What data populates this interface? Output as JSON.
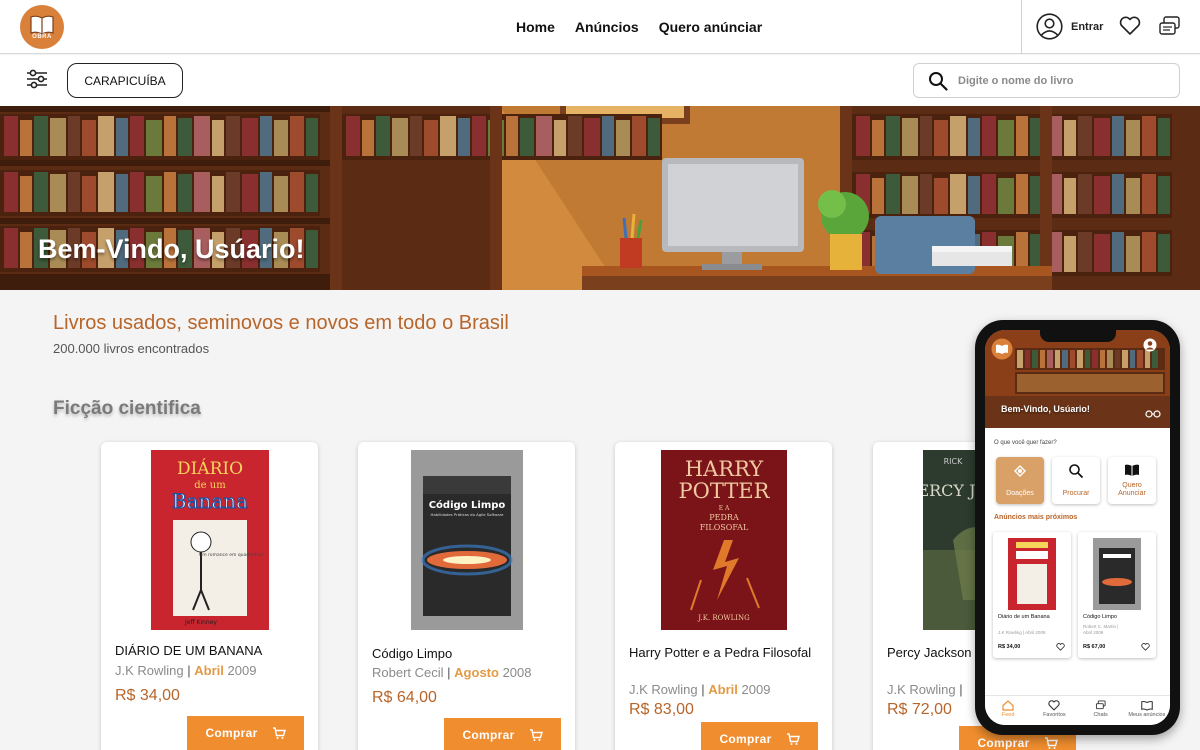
{
  "header": {
    "logo_text": "OBRA",
    "nav": [
      "Home",
      "Anúncios",
      "Quero anúnciar"
    ],
    "login_label": "Entrar"
  },
  "filters": {
    "city": "CARAPICUÍBA",
    "search_placeholder": "Digite o nome do livro"
  },
  "hero": {
    "title": "Bem-Vindo, Usúario!"
  },
  "main": {
    "headline": "Livros usados, seminovos e novos em todo o Brasil",
    "count": "200.000 livros encontrados",
    "category": "Ficção cientifica",
    "buy_label": "Comprar",
    "books": [
      {
        "title": "DIÁRIO DE UM BANANA",
        "author": "J.K Rowling",
        "month": "Abril",
        "year": "2009",
        "price": "R$ 34,00"
      },
      {
        "title": "Código Limpo",
        "author": "Robert Cecil",
        "month": "Agosto",
        "year": "2008",
        "price": "R$ 64,00"
      },
      {
        "title": "Harry Potter e a Pedra Filosofal",
        "author": "J.K Rowling",
        "month": "Abril",
        "year": "2009",
        "price": "R$ 83,00"
      },
      {
        "title": "Percy Jackson e os Olimpianos",
        "author": "J.K Rowling",
        "month": "",
        "year": "",
        "price": "R$ 72,00"
      }
    ],
    "covers": {
      "banana_title": "DIÁRIO",
      "banana_sub": "de um",
      "banana_word": "Banana",
      "banana_note": "Um romance em quadrinhos",
      "banana_author": "Jeff Kinney",
      "codigo_title": "Código Limpo",
      "codigo_sub": "Habilidades Práticas do Agile Software",
      "hp_title_1": "HARRY",
      "hp_title_2": "POTTER",
      "hp_sub_1": "E A",
      "hp_sub_2": "PEDRA",
      "hp_sub_3": "FILOSOFAL",
      "hp_author": "J.K. ROWLING",
      "percy_author": "RICK",
      "percy_title": "PERCY JACKSON"
    }
  },
  "phone": {
    "hero_title": "Bem-Vindo, Usúario!",
    "question": "O que você quer fazer?",
    "actions": [
      "Doações",
      "Procurar",
      "Quero Anunciar"
    ],
    "nearby_title": "Anúncios mais próximos",
    "cards": [
      {
        "title": "Diário de um Banana",
        "meta_1": "J.K Rowling | Abril 2009",
        "price": "R$ 34,00"
      },
      {
        "title": "Código Limpo",
        "meta_1": "Robert C. Martin |",
        "meta_2": "Abril 2009",
        "price": "R$ 67,00"
      }
    ],
    "tabs": [
      "Feed",
      "Favoritos",
      "Chats",
      "Meus anúncios"
    ]
  },
  "colors": {
    "accent": "#ef8d2f",
    "brand": "#d9813b",
    "heading": "#b8652a"
  }
}
